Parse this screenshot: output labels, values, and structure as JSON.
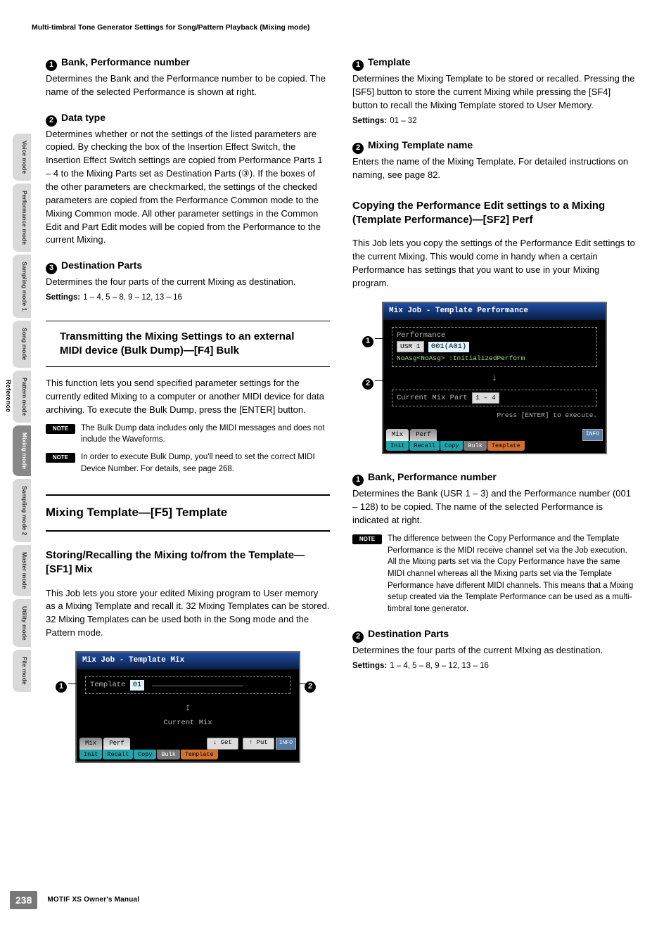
{
  "header": "Multi-timbral Tone Generator Settings for Song/Pattern Playback (Mixing mode)",
  "side": {
    "ref": "Reference",
    "tabs": [
      "Voice mode",
      "Performance mode",
      "Sampling mode 1",
      "Song mode",
      "Pattern mode",
      "Mixing mode",
      "Sampling mode 2",
      "Master mode",
      "Utility mode",
      "File mode"
    ]
  },
  "left": {
    "i1": {
      "title": "Bank, Performance number",
      "body": "Determines the Bank and the Performance number to be copied. The name of the selected Performance is shown at right."
    },
    "i2": {
      "title": "Data type",
      "body": "Determines whether or not the settings of the listed parameters are copied. By checking the box of the Insertion Effect Switch, the Insertion Effect Switch settings are copied from Performance Parts 1 – 4 to the Mixing Parts set as Destination Parts (③). If the boxes of the other parameters are checkmarked, the settings of the checked parameters are copied from the Performance Common mode to the Mixing Common mode. All other parameter settings in the Common Edit and Part Edit modes will be copied from the Performance to the current Mixing."
    },
    "i3": {
      "title": "Destination Parts",
      "body": "Determines the four parts of the current Mixing as destination.",
      "settings": "1 – 4, 5 – 8, 9 – 12, 13 – 16"
    },
    "bulk": {
      "title": "Transmitting the Mixing Settings to an external MIDI device (Bulk Dump)—[F4] Bulk",
      "body": "This function lets you send specified parameter settings for the currently edited Mixing to a computer or another MIDI device for data archiving. To execute the Bulk Dump, press the [ENTER] button.",
      "note1": "The Bulk Dump data includes only the MIDI messages and does not include the Waveforms.",
      "note2": "In order to execute Bulk Dump, you'll need to set the correct MIDI Device Number. For details, see page 268."
    },
    "template_section": "Mixing Template—[F5] Template",
    "store": {
      "title": "Storing/Recalling the Mixing to/from the Template—[SF1] Mix",
      "body": "This Job lets you store your edited Mixing program to User memory as a Mixing Template and recall it. 32 Mixing Templates can be stored. 32 Mixing Templates can be used both in the Song mode and the Pattern mode."
    },
    "fig1": {
      "title": "Mix Job - Template Mix",
      "tmpl_label": "Template",
      "tmpl_val": "01",
      "tmpl_name": "",
      "current": "Current Mix",
      "tabs": {
        "mix": "Mix",
        "perf": "Perf"
      },
      "btn_get": "↓ Get",
      "btn_put": "↑ Put",
      "info": "INFO",
      "subs": {
        "init": "Init",
        "recall": "Recall",
        "copy": "Copy",
        "bulk": "Bulk",
        "template": "Template"
      }
    }
  },
  "right": {
    "i1": {
      "title": "Template",
      "body": "Determines the Mixing Template to be stored or recalled. Pressing the [SF5] button to store the current Mixing while pressing the [SF4] button to recall the Mixing Template stored to User Memory.",
      "settings": "01 – 32"
    },
    "i2": {
      "title": "Mixing Template name",
      "body": "Enters the name of the Mixing Template. For detailed instructions on naming, see page 82."
    },
    "copyperf": {
      "title": "Copying the Performance Edit settings to a Mixing (Template Performance)—[SF2] Perf",
      "body": "This Job lets you copy the settings of the Performance Edit settings to the current Mixing. This would come in handy when a certain Performance has settings that you want to use in your Mixing program."
    },
    "fig2": {
      "title": "Mix Job - Template Performance",
      "perf_label": "Performance",
      "bank": "USR 1",
      "num": "001(A01)",
      "perf_line": "NoAsg<NoAsg> :InitializedPerform",
      "part_label": "Current Mix Part",
      "part_val": "1 – 4",
      "prompt": "Press [ENTER] to execute.",
      "tabs": {
        "mix": "Mix",
        "perf": "Perf"
      },
      "info": "INFO",
      "subs": {
        "init": "Init",
        "recall": "Recall",
        "copy": "Copy",
        "bulk": "Bulk",
        "template": "Template"
      }
    },
    "i1b": {
      "title": "Bank, Performance number",
      "body": "Determines the Bank (USR 1 – 3) and the Performance number (001 – 128) to be copied. The name of the selected Performance is indicated at right."
    },
    "note": "The difference between the Copy Performance and the Template Performance is the MIDI receive channel set via the Job execution. All the Mixing parts set via the Copy Performance have the same MIDI channel whereas all the Mixing parts set via the Template Performance have different MIDI channels. This means that a Mixing setup created via the Template Performance can be used as a multi-timbral tone generator.",
    "i2b": {
      "title": "Destination Parts",
      "body": "Determines the four parts of the current MIxing as destination.",
      "settings": "1 – 4, 5 – 8, 9 – 12, 13 – 16"
    }
  },
  "note_label": "NOTE",
  "settings_label": "Settings:",
  "footer": {
    "page": "238",
    "text": "MOTIF XS Owner's Manual"
  }
}
